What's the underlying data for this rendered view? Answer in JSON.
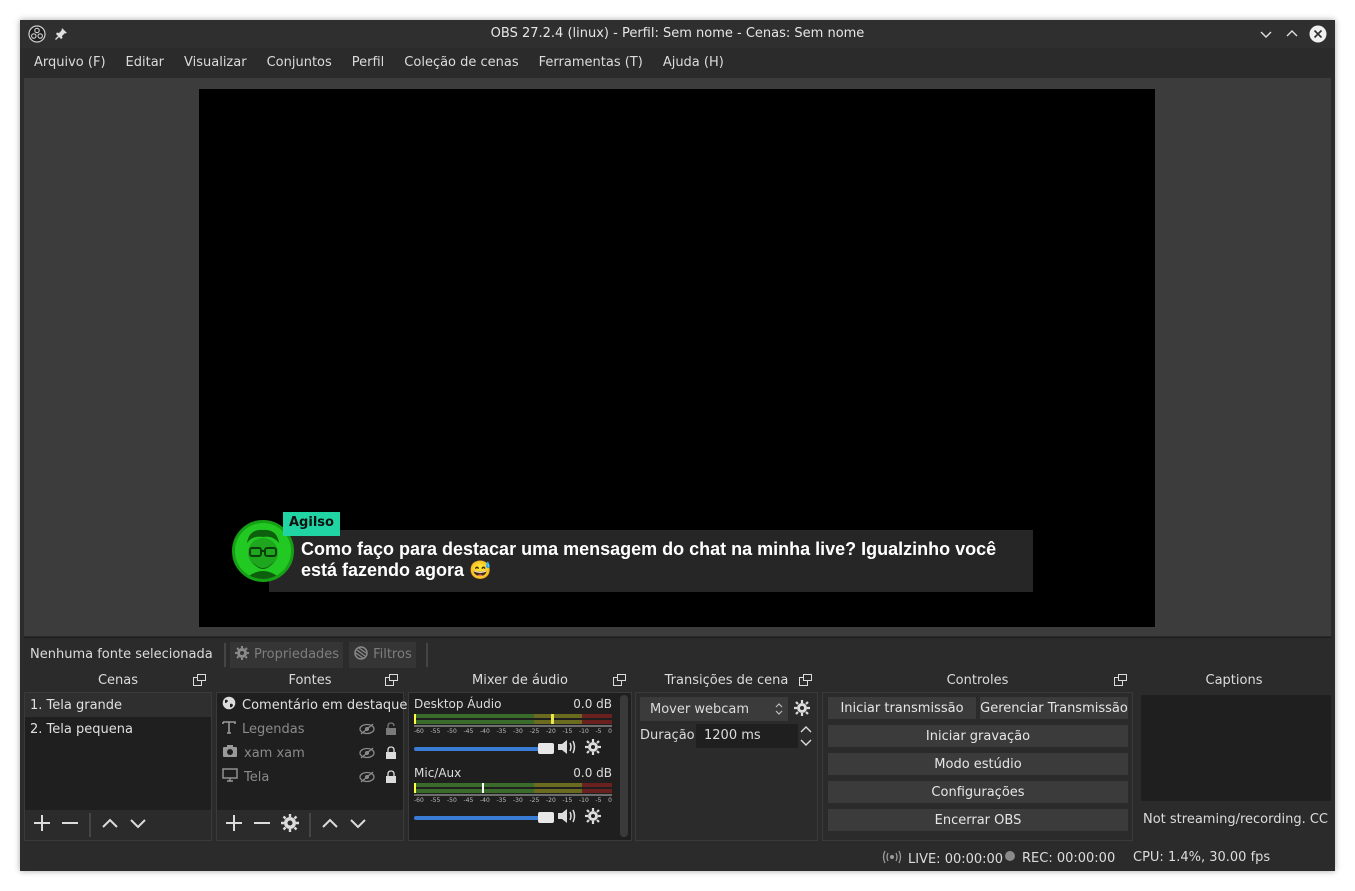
{
  "window": {
    "title": "OBS 27.2.4 (linux) - Perfil: Sem nome - Cenas: Sem nome"
  },
  "menu": [
    "Arquivo (F)",
    "Editar",
    "Visualizar",
    "Conjuntos",
    "Perfil",
    "Coleção de cenas",
    "Ferramentas (T)",
    "Ajuda (H)"
  ],
  "chat": {
    "username": "Agilso",
    "message": "Como faço para destacar uma mensagem do chat na minha live? Igualzinho você está fazendo agora 😅"
  },
  "source_toolbar": {
    "no_source": "Nenhuma fonte selecionada",
    "properties": "Propriedades",
    "filters": "Filtros"
  },
  "scenes": {
    "title": "Cenas",
    "items": [
      "1. Tela grande",
      "2. Tela pequena"
    ]
  },
  "sources": {
    "title": "Fontes",
    "items": [
      "Comentário em destaque",
      "Legendas",
      "xam xam",
      "Tela"
    ]
  },
  "mixer": {
    "title": "Mixer de áudio",
    "channels": [
      {
        "name": "Desktop Áudio",
        "db": "0.0 dB",
        "volume_percent": 100
      },
      {
        "name": "Mic/Aux",
        "db": "0.0 dB",
        "volume_percent": 100
      }
    ],
    "ticks": [
      "-60",
      "-55",
      "-50",
      "-45",
      "-40",
      "-35",
      "-30",
      "-25",
      "-20",
      "-15",
      "-10",
      "-5",
      "0"
    ]
  },
  "transitions": {
    "title": "Transições de cena",
    "selected": "Mover webcam",
    "duration_label": "Duração",
    "duration_value": "1200 ms"
  },
  "controls": {
    "title": "Controles",
    "start_stream": "Iniciar transmissão",
    "manage_stream": "Gerenciar Transmissão",
    "start_recording": "Iniciar gravação",
    "studio_mode": "Modo estúdio",
    "settings": "Configurações",
    "exit": "Encerrar OBS"
  },
  "captions": {
    "title": "Captions",
    "status": "Not streaming/recording. CC Off"
  },
  "status": {
    "live": "LIVE: 00:00:00",
    "rec": "REC: 00:00:00",
    "cpu": "CPU: 1.4%, 30.00 fps"
  }
}
